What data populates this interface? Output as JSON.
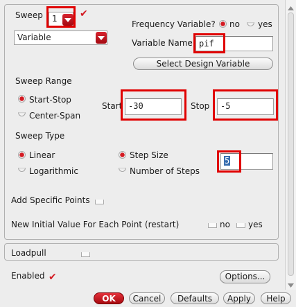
{
  "sweep": {
    "label": "Sweep",
    "index_value": "1",
    "type_value": "Variable"
  },
  "freq_var": {
    "label": "Frequency Variable?",
    "no_label": "no",
    "yes_label": "yes",
    "selected": "no"
  },
  "var_name": {
    "label": "Variable Name",
    "value": "pif"
  },
  "select_var_button": "Select Design Variable",
  "sweep_range": {
    "heading": "Sweep Range",
    "start_stop_label": "Start-Stop",
    "center_span_label": "Center-Span",
    "selected": "Start-Stop",
    "start_label": "Start",
    "start_value": "-30",
    "stop_label": "Stop",
    "stop_value": "-5"
  },
  "sweep_type": {
    "heading": "Sweep Type",
    "linear_label": "Linear",
    "log_label": "Logarithmic",
    "selected": "Linear",
    "step_size_label": "Step Size",
    "num_steps_label": "Number of Steps",
    "step_selected": "Step Size",
    "step_value": "5"
  },
  "add_points": {
    "label": "Add Specific Points",
    "checked": false
  },
  "initial_value": {
    "label": "New Initial Value For Each Point (restart)",
    "no_label": "no",
    "yes_label": "yes"
  },
  "loadpull": {
    "label": "Loadpull",
    "checked": false
  },
  "enabled": {
    "label": "Enabled",
    "checked": true
  },
  "buttons": {
    "options": "Options...",
    "ok": "OK",
    "cancel": "Cancel",
    "defaults": "Defaults",
    "apply": "Apply",
    "help": "Help"
  },
  "colors": {
    "accent": "#d31a22",
    "highlight": "#e00000"
  }
}
